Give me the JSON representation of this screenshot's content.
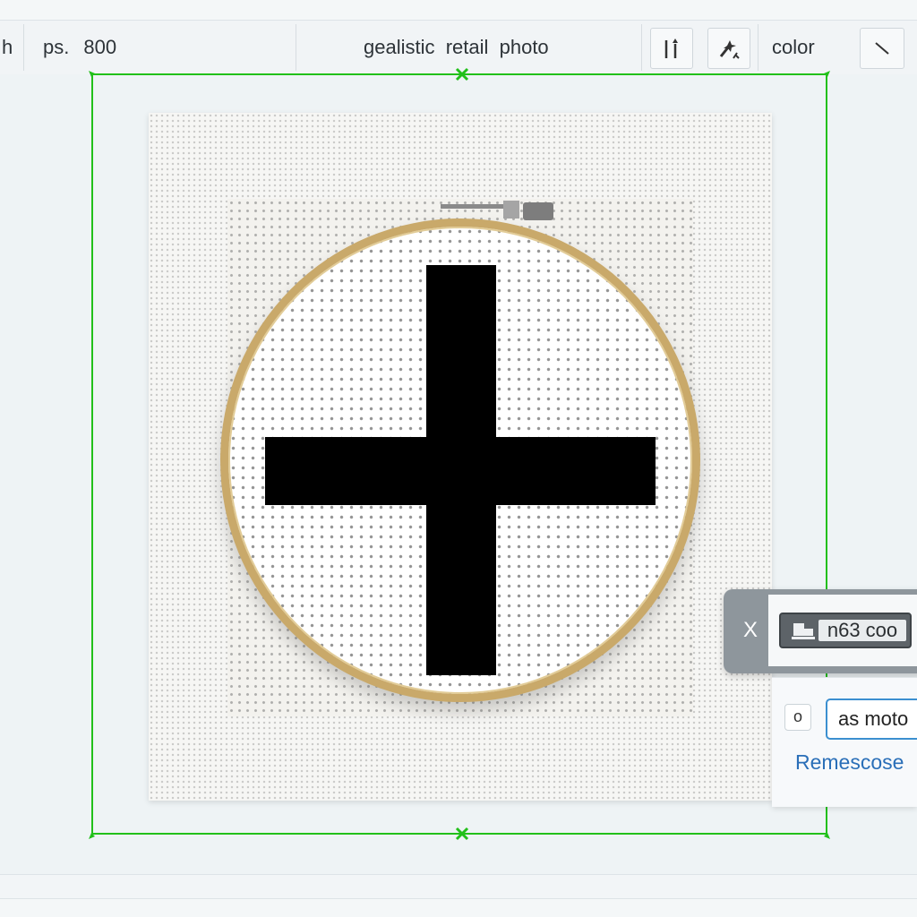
{
  "toolbar": {
    "left_fragment": "h",
    "size_label": "ps.",
    "size_value": "800",
    "prompt_text": "gealistic  retail  photo",
    "color_label": "color",
    "tools": [
      {
        "name": "align-icon"
      },
      {
        "name": "magic-wand-icon"
      },
      {
        "name": "line-tool-icon"
      }
    ]
  },
  "canvas": {
    "image_subject": "embroidery hoop with black cross stitch",
    "selection_color": "#22c01a",
    "hoop_color": "#c9a96a"
  },
  "float_panel": {
    "close_label": "X",
    "tag_label": "n63 coo"
  },
  "sub_panel": {
    "option_label": "o",
    "input_value": "as moto",
    "link_text": "Remescose"
  }
}
